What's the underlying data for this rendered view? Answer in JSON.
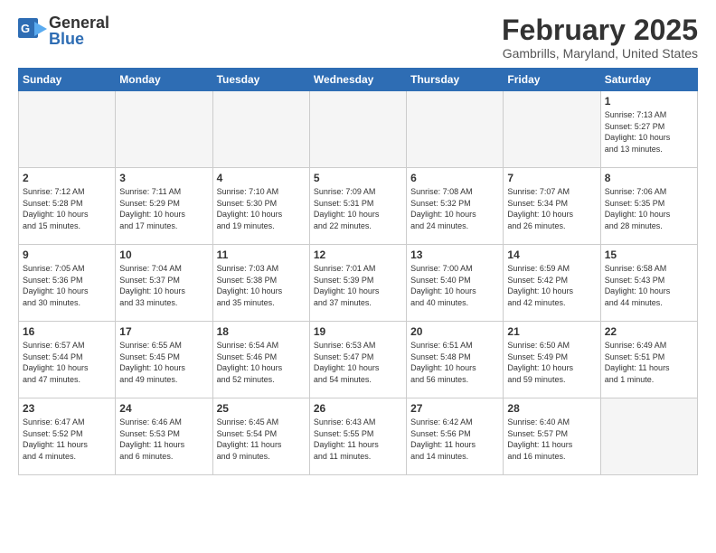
{
  "header": {
    "logo_general": "General",
    "logo_blue": "Blue",
    "month_title": "February 2025",
    "location": "Gambrills, Maryland, United States"
  },
  "weekdays": [
    "Sunday",
    "Monday",
    "Tuesday",
    "Wednesday",
    "Thursday",
    "Friday",
    "Saturday"
  ],
  "weeks": [
    [
      {
        "day": "",
        "info": ""
      },
      {
        "day": "",
        "info": ""
      },
      {
        "day": "",
        "info": ""
      },
      {
        "day": "",
        "info": ""
      },
      {
        "day": "",
        "info": ""
      },
      {
        "day": "",
        "info": ""
      },
      {
        "day": "1",
        "info": "Sunrise: 7:13 AM\nSunset: 5:27 PM\nDaylight: 10 hours\nand 13 minutes."
      }
    ],
    [
      {
        "day": "2",
        "info": "Sunrise: 7:12 AM\nSunset: 5:28 PM\nDaylight: 10 hours\nand 15 minutes."
      },
      {
        "day": "3",
        "info": "Sunrise: 7:11 AM\nSunset: 5:29 PM\nDaylight: 10 hours\nand 17 minutes."
      },
      {
        "day": "4",
        "info": "Sunrise: 7:10 AM\nSunset: 5:30 PM\nDaylight: 10 hours\nand 19 minutes."
      },
      {
        "day": "5",
        "info": "Sunrise: 7:09 AM\nSunset: 5:31 PM\nDaylight: 10 hours\nand 22 minutes."
      },
      {
        "day": "6",
        "info": "Sunrise: 7:08 AM\nSunset: 5:32 PM\nDaylight: 10 hours\nand 24 minutes."
      },
      {
        "day": "7",
        "info": "Sunrise: 7:07 AM\nSunset: 5:34 PM\nDaylight: 10 hours\nand 26 minutes."
      },
      {
        "day": "8",
        "info": "Sunrise: 7:06 AM\nSunset: 5:35 PM\nDaylight: 10 hours\nand 28 minutes."
      }
    ],
    [
      {
        "day": "9",
        "info": "Sunrise: 7:05 AM\nSunset: 5:36 PM\nDaylight: 10 hours\nand 30 minutes."
      },
      {
        "day": "10",
        "info": "Sunrise: 7:04 AM\nSunset: 5:37 PM\nDaylight: 10 hours\nand 33 minutes."
      },
      {
        "day": "11",
        "info": "Sunrise: 7:03 AM\nSunset: 5:38 PM\nDaylight: 10 hours\nand 35 minutes."
      },
      {
        "day": "12",
        "info": "Sunrise: 7:01 AM\nSunset: 5:39 PM\nDaylight: 10 hours\nand 37 minutes."
      },
      {
        "day": "13",
        "info": "Sunrise: 7:00 AM\nSunset: 5:40 PM\nDaylight: 10 hours\nand 40 minutes."
      },
      {
        "day": "14",
        "info": "Sunrise: 6:59 AM\nSunset: 5:42 PM\nDaylight: 10 hours\nand 42 minutes."
      },
      {
        "day": "15",
        "info": "Sunrise: 6:58 AM\nSunset: 5:43 PM\nDaylight: 10 hours\nand 44 minutes."
      }
    ],
    [
      {
        "day": "16",
        "info": "Sunrise: 6:57 AM\nSunset: 5:44 PM\nDaylight: 10 hours\nand 47 minutes."
      },
      {
        "day": "17",
        "info": "Sunrise: 6:55 AM\nSunset: 5:45 PM\nDaylight: 10 hours\nand 49 minutes."
      },
      {
        "day": "18",
        "info": "Sunrise: 6:54 AM\nSunset: 5:46 PM\nDaylight: 10 hours\nand 52 minutes."
      },
      {
        "day": "19",
        "info": "Sunrise: 6:53 AM\nSunset: 5:47 PM\nDaylight: 10 hours\nand 54 minutes."
      },
      {
        "day": "20",
        "info": "Sunrise: 6:51 AM\nSunset: 5:48 PM\nDaylight: 10 hours\nand 56 minutes."
      },
      {
        "day": "21",
        "info": "Sunrise: 6:50 AM\nSunset: 5:49 PM\nDaylight: 10 hours\nand 59 minutes."
      },
      {
        "day": "22",
        "info": "Sunrise: 6:49 AM\nSunset: 5:51 PM\nDaylight: 11 hours\nand 1 minute."
      }
    ],
    [
      {
        "day": "23",
        "info": "Sunrise: 6:47 AM\nSunset: 5:52 PM\nDaylight: 11 hours\nand 4 minutes."
      },
      {
        "day": "24",
        "info": "Sunrise: 6:46 AM\nSunset: 5:53 PM\nDaylight: 11 hours\nand 6 minutes."
      },
      {
        "day": "25",
        "info": "Sunrise: 6:45 AM\nSunset: 5:54 PM\nDaylight: 11 hours\nand 9 minutes."
      },
      {
        "day": "26",
        "info": "Sunrise: 6:43 AM\nSunset: 5:55 PM\nDaylight: 11 hours\nand 11 minutes."
      },
      {
        "day": "27",
        "info": "Sunrise: 6:42 AM\nSunset: 5:56 PM\nDaylight: 11 hours\nand 14 minutes."
      },
      {
        "day": "28",
        "info": "Sunrise: 6:40 AM\nSunset: 5:57 PM\nDaylight: 11 hours\nand 16 minutes."
      },
      {
        "day": "",
        "info": ""
      }
    ]
  ]
}
